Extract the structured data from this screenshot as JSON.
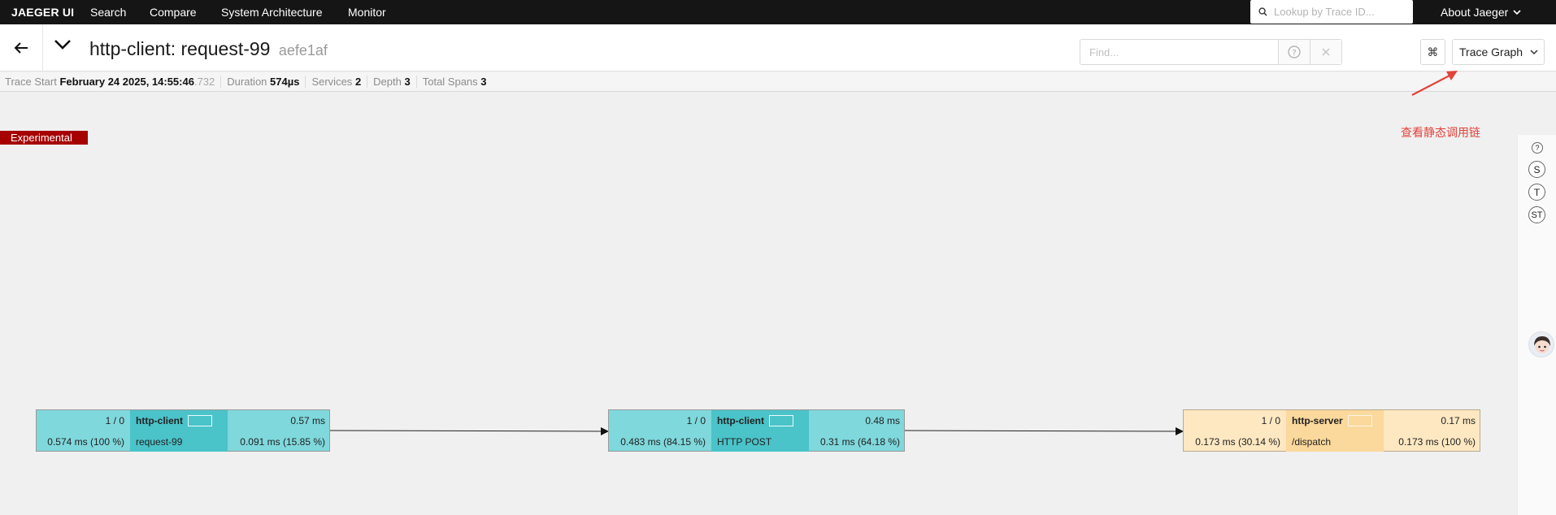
{
  "nav": {
    "brand": "JAEGER UI",
    "links": [
      "Search",
      "Compare",
      "System Architecture",
      "Monitor"
    ],
    "lookup_placeholder": "Lookup by Trace ID...",
    "about": "About Jaeger"
  },
  "trace": {
    "title": "http-client: request-99",
    "trace_id": "aefe1af",
    "find_placeholder": "Find...",
    "kbd_glyph": "⌘",
    "view_mode": "Trace Graph"
  },
  "overview": {
    "trace_start_label": "Trace Start",
    "trace_start_main": "February 24 2025, 14:55:46",
    "trace_start_ms": ".732",
    "duration_label": "Duration",
    "duration": "574µs",
    "services_label": "Services",
    "services": "2",
    "depth_label": "Depth",
    "depth": "3",
    "total_spans_label": "Total Spans",
    "total_spans": "3"
  },
  "experimental_tag": "Experimental",
  "annotation": "查看静态调用链",
  "zoom_buttons": [
    "?",
    "S",
    "T",
    "ST"
  ],
  "nodes": [
    {
      "count": "1 / 0",
      "service": "http-client",
      "time": "0.57 ms",
      "total": "0.574 ms (100 %)",
      "operation": "request-99",
      "self": "0.091 ms (15.85 %)"
    },
    {
      "count": "1 / 0",
      "service": "http-client",
      "time": "0.48 ms",
      "total": "0.483 ms (84.15 %)",
      "operation": "HTTP POST",
      "self": "0.31 ms (64.18 %)"
    },
    {
      "count": "1 / 0",
      "service": "http-server",
      "time": "0.17 ms",
      "total": "0.173 ms (30.14 %)",
      "operation": "/dispatch",
      "self": "0.173 ms (100 %)"
    }
  ],
  "colors": {
    "client": "#4ac3c9",
    "server": "#fbd89c",
    "accent_red": "#e0443b",
    "experimental": "#a60000"
  }
}
